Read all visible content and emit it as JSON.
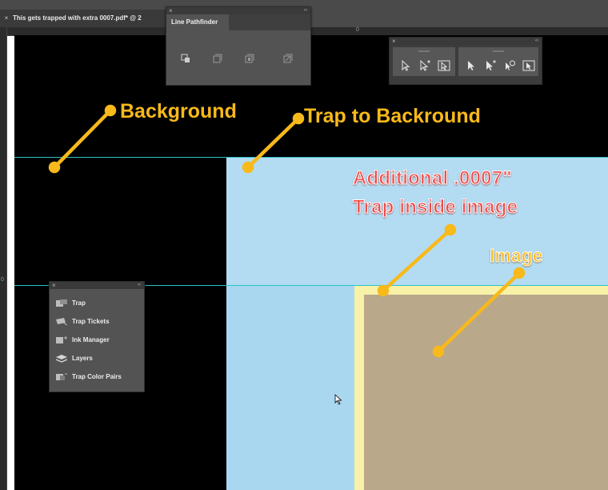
{
  "document_tab": {
    "close_glyph": "×",
    "title": "This gets trapped with extra 0007.pdf* @ 2"
  },
  "rulers": {
    "top_tick_label": "0",
    "left_tick_label": "0"
  },
  "line_pathfinder_panel": {
    "close_glyph": "×",
    "collapse_glyph": "‹‹",
    "tab_label": "Line Pathfinder",
    "icons": [
      "pathfinder-add-icon",
      "pathfinder-subtract-icon",
      "pathfinder-intersect-icon",
      "pathfinder-exclude-icon"
    ]
  },
  "direct_tools_panel": {
    "close_glyph": "×",
    "collapse_glyph": "‹‹",
    "group1": [
      "hollow-arrow-icon",
      "hollow-arrow-plus-icon",
      "hollow-select-box-icon"
    ],
    "group2": [
      "filled-arrow-icon",
      "filled-arrow-plus-icon",
      "filled-lasso-icon",
      "filled-select-box-icon"
    ]
  },
  "trap_menu_panel": {
    "close_glyph": "×",
    "collapse_glyph": "‹‹",
    "items": [
      {
        "label": "Trap",
        "icon": "trap-icon"
      },
      {
        "label": "Trap Tickets",
        "icon": "trap-tickets-icon"
      },
      {
        "label": "Ink Manager",
        "icon": "ink-manager-icon"
      },
      {
        "label": "Layers",
        "icon": "layers-icon"
      },
      {
        "label": "Trap Color Pairs",
        "icon": "trap-color-pairs-icon"
      }
    ]
  },
  "annotations": {
    "background": "Background",
    "trap_to_background": "Trap to Backround",
    "additional_line1": "Additional .0007\"",
    "additional_line2": "Trap inside image",
    "image": "Image"
  },
  "colors": {
    "canvas_background": "#000000",
    "trap_zone": "#b3dcf2",
    "image_border": "#f7f2a8",
    "image_fill": "#baa88a",
    "guide_line": "#29c3c9",
    "annotation_yellow": "#f8b91a",
    "annotation_red": "#f04a4a"
  }
}
